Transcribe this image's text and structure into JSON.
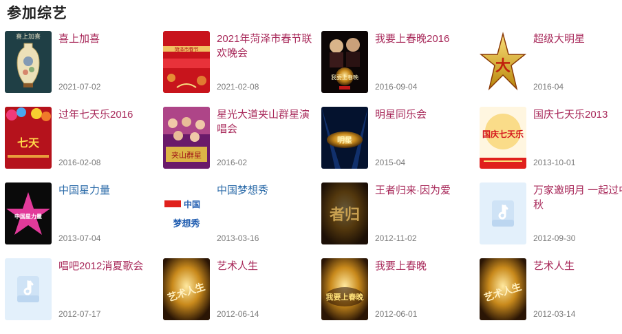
{
  "section_title": "参加综艺",
  "shows": [
    {
      "name": "喜上加喜",
      "date": "2021-07-02",
      "thumb_text": "喜上加喜",
      "thumb": "vase"
    },
    {
      "name": "2021年菏泽市春节联欢晚会",
      "date": "2021-02-08",
      "thumb_text": "菏泽市春节",
      "thumb": "red-banner"
    },
    {
      "name": "我要上春晚2016",
      "date": "2016-09-04",
      "thumb_text": "我要上春晚",
      "thumb": "gala-dark"
    },
    {
      "name": "超级大明星",
      "date": "2016-04",
      "thumb_text": "大",
      "thumb": "gold-star"
    },
    {
      "name": "过年七天乐2016",
      "date": "2016-02-08",
      "thumb_text": "七天",
      "thumb": "balloons"
    },
    {
      "name": "星光大道夹山群星演唱会",
      "date": "2016-02",
      "thumb_text": "夹山群星",
      "thumb": "stars-group"
    },
    {
      "name": "明星同乐会",
      "date": "2015-04",
      "thumb_text": "明星",
      "thumb": "blue-stage"
    },
    {
      "name": "国庆七天乐2013",
      "date": "2013-10-01",
      "thumb_text": "国庆七天乐",
      "thumb": "national-day"
    },
    {
      "name": "中国星力量",
      "date": "2013-07-04",
      "thumb_text": "中国星力量",
      "thumb": "pink-star",
      "name_color": "blue"
    },
    {
      "name": "中国梦想秀",
      "date": "2013-03-16",
      "thumb_text": "中国梦想秀",
      "thumb": "dream-logo",
      "name_color": "blue"
    },
    {
      "name": "王者归来·因为爱",
      "date": "2012-11-02",
      "thumb_text": "者归",
      "thumb": "dark-gold"
    },
    {
      "name": "万家邀明月 一起过中秋",
      "date": "2012-09-30",
      "thumb_text": "",
      "thumb": "placeholder"
    },
    {
      "name": "唱吧2012消夏歌会",
      "date": "2012-07-17",
      "thumb_text": "",
      "thumb": "placeholder"
    },
    {
      "name": "艺术人生",
      "date": "2012-06-14",
      "thumb_text": "艺术人生",
      "thumb": "art-life"
    },
    {
      "name": "我要上春晚",
      "date": "2012-06-01",
      "thumb_text": "我要上春晚",
      "thumb": "gala-gold"
    },
    {
      "name": "艺术人生",
      "date": "2012-03-14",
      "thumb_text": "艺术人生",
      "thumb": "art-life"
    }
  ]
}
